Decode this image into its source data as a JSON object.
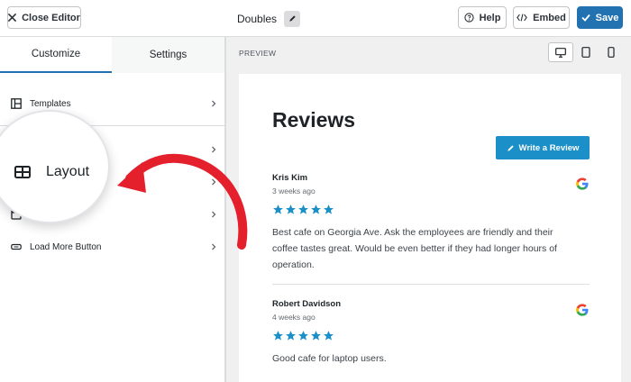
{
  "topbar": {
    "close_label": "Close Editor",
    "title": "Doubles",
    "help_label": "Help",
    "embed_label": "Embed",
    "save_label": "Save"
  },
  "sidebar": {
    "tabs": [
      {
        "label": "Customize",
        "active": true
      },
      {
        "label": "Settings",
        "active": false
      }
    ],
    "items": [
      {
        "label": "Templates",
        "icon": "templates-icon"
      },
      {
        "label": "Layout",
        "icon": "layout-icon"
      },
      {
        "label": "",
        "icon": "header-icon"
      },
      {
        "label": "",
        "icon": "reviews-icon"
      },
      {
        "label": "Load More Button",
        "icon": "button-icon"
      }
    ],
    "magnifier_label": "Layout"
  },
  "preview": {
    "label": "PREVIEW",
    "devices": [
      "desktop",
      "tablet",
      "mobile"
    ],
    "active_device": "desktop",
    "heading": "Reviews",
    "write_button": "Write a Review",
    "reviews": [
      {
        "name": "Kris Kim",
        "date": "3 weeks ago",
        "stars": 5,
        "text": "Best cafe on Georgia Ave. Ask the employees are friendly and their coffee tastes great. Would be even better if they had longer hours of operation."
      },
      {
        "name": "Robert Davidson",
        "date": "4 weeks ago",
        "stars": 5,
        "text": "Good cafe for laptop users."
      }
    ]
  },
  "colors": {
    "accent": "#2271b1",
    "write_button": "#1a8fc8",
    "stars": "#1a8fc8",
    "arrow": "#e4202c"
  }
}
